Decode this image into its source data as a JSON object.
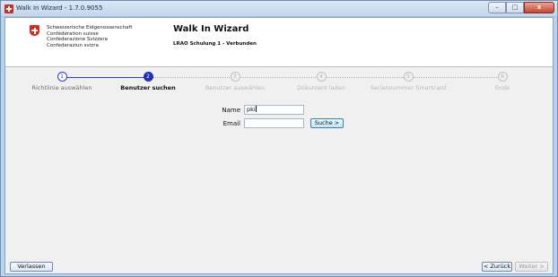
{
  "window": {
    "title": "Walk In Wizard - 1.7.0.9055",
    "controls": {
      "minimize": "–",
      "maximize": "□",
      "close": "x"
    }
  },
  "header": {
    "org_lines": [
      "Schweizerische Eidgenossenschaft",
      "Confédération suisse",
      "Confederazione Svizzera",
      "Confederaziun svizra"
    ],
    "title": "Walk In Wizard",
    "subtitle": "LRAO Schulung 1 - Verbunden"
  },
  "steps": [
    {
      "number": "1",
      "label": "Richtlinie auswählen",
      "state": "done"
    },
    {
      "number": "2",
      "label": "Benutzer suchen",
      "state": "active"
    },
    {
      "number": "3",
      "label": "Benutzer auswählen",
      "state": "pending"
    },
    {
      "number": "4",
      "label": "Dokument laden",
      "state": "pending"
    },
    {
      "number": "5",
      "label": "Seriennummer Smartcard",
      "state": "pending"
    },
    {
      "number": "6",
      "label": "Ende",
      "state": "pending"
    }
  ],
  "form": {
    "name_label": "Name",
    "name_value": "pki",
    "email_label": "Email",
    "email_value": "",
    "search_button": "Suche >"
  },
  "footer": {
    "exit_button": "Verlassen",
    "back_button": "< Zurück",
    "next_button": "Weiter >"
  },
  "colors": {
    "accent": "#1e2fbf",
    "swiss_red": "#d52b1e",
    "pending": "#b4b4b4"
  }
}
